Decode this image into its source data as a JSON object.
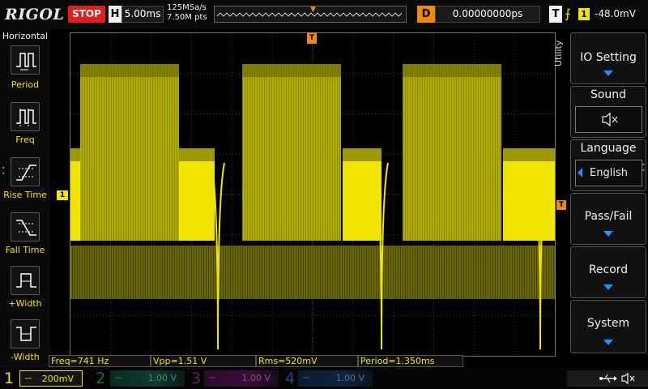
{
  "topbar": {
    "logo": "RIGOL",
    "run_state": "STOP",
    "horizontal_label": "H",
    "horizontal_scale": "5.00ms",
    "sample_rate": "125MSa/s",
    "memory_depth": "7.50M pts",
    "delay_label": "D",
    "delay_value": "0.00000000ps",
    "trigger_label": "T",
    "trigger_edge_icon": "rising-edge-icon",
    "trigger_source": "1",
    "trigger_level": "-48.0mV"
  },
  "left_menu": {
    "title": "Horizontal",
    "items": [
      {
        "label": "Period",
        "icon": "period-icon"
      },
      {
        "label": "Freq",
        "icon": "frequency-icon"
      },
      {
        "label": "Rise Time",
        "icon": "rise-time-icon"
      },
      {
        "label": "Fall Time",
        "icon": "fall-time-icon"
      },
      {
        "label": "+Width",
        "icon": "positive-width-icon"
      },
      {
        "label": "-Width",
        "icon": "negative-width-icon"
      }
    ]
  },
  "screen": {
    "ch1_marker": "1",
    "trigger_marker": "T",
    "trigger_level_marker": "T"
  },
  "right_menu": {
    "tab_label": "Utility",
    "items": [
      {
        "title": "IO Setting"
      },
      {
        "title": "Sound",
        "value_icon": "speaker-muted-icon"
      },
      {
        "title": "Language",
        "value": "English"
      },
      {
        "title": "Pass/Fail"
      },
      {
        "title": "Record"
      },
      {
        "title": "System"
      }
    ]
  },
  "measurements": [
    {
      "text": "Freq=741 Hz"
    },
    {
      "text": "Vpp=1.51 V"
    },
    {
      "text": "Rms=520mV"
    },
    {
      "text": "Period=1.350ms"
    }
  ],
  "channels": [
    {
      "num": "1",
      "scale": "200mV",
      "color": "#f2e600",
      "coupling": "DC"
    },
    {
      "num": "2",
      "scale": "1.00 V",
      "color": "#1a6b5a"
    },
    {
      "num": "3",
      "scale": "1.00 V",
      "color": "#6b1a6b"
    },
    {
      "num": "4",
      "scale": "1.00 V",
      "color": "#1a4a7a"
    }
  ],
  "status": {
    "usb_icon": "usb-icon",
    "sound_icon": "speaker-muted-icon"
  },
  "colors": {
    "ch1": "#f2e600",
    "trigger": "#f08a00",
    "stop": "#e41c1c",
    "menu_arrow": "#1e90ff"
  }
}
